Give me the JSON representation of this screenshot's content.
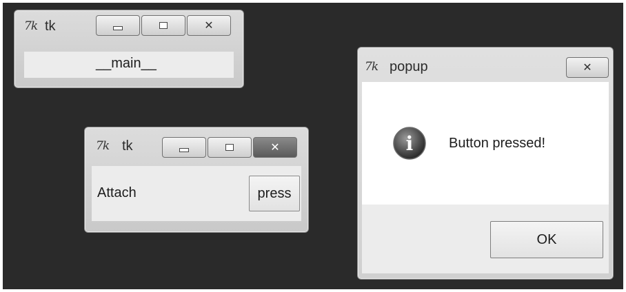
{
  "main_window": {
    "title": "tk",
    "icon": "tk-feather-icon",
    "label": "__main__"
  },
  "attach_window": {
    "title": "tk",
    "icon": "tk-feather-icon",
    "label": "Attach",
    "button": "press"
  },
  "popup": {
    "title": "popup",
    "icon": "tk-feather-icon",
    "message": "Button pressed!",
    "info_icon": "info-icon",
    "ok_button": "OK"
  },
  "glyphs": {
    "tk_logo": "7k",
    "close": "✕",
    "info": "i"
  }
}
